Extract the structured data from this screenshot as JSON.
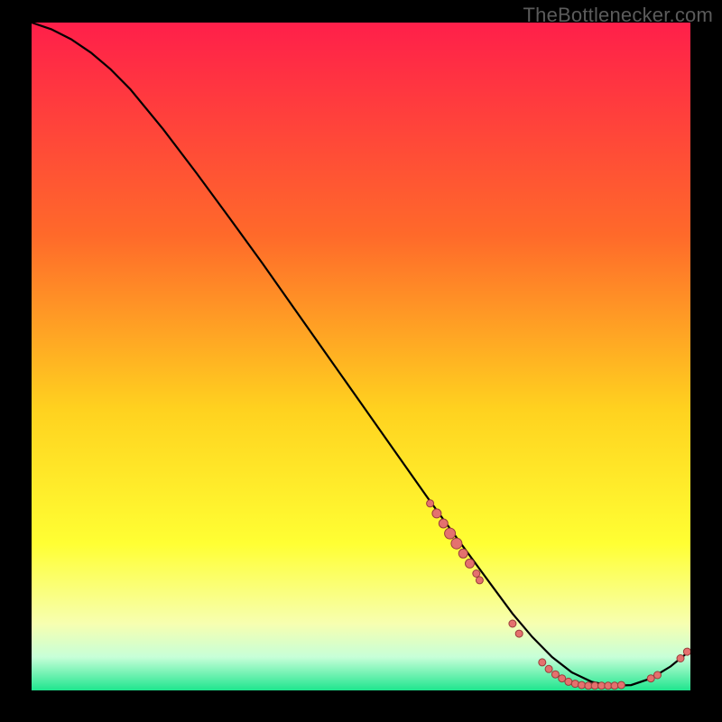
{
  "watermark": "TheBottlenecker.com",
  "colors": {
    "bg_black": "#000000",
    "grad_top": "#ff1f4a",
    "grad_mid1": "#ff6a2a",
    "grad_mid2": "#ffd21f",
    "grad_mid3": "#ffff33",
    "grad_low1": "#f7ffb0",
    "grad_low2": "#c7ffd8",
    "grad_bottom": "#1fe58e",
    "curve": "#000000",
    "dot_fill": "#e4716e",
    "dot_stroke": "#9a3d3b"
  },
  "chart_data": {
    "type": "line",
    "title": "",
    "xlabel": "",
    "ylabel": "",
    "xlim": [
      0,
      100
    ],
    "ylim": [
      0,
      100
    ],
    "series": [
      {
        "name": "curve",
        "x": [
          0,
          3,
          6,
          9,
          12,
          15,
          20,
          25,
          30,
          35,
          40,
          45,
          50,
          55,
          60,
          65,
          70,
          73,
          76,
          79,
          82,
          85,
          88,
          91,
          94,
          97,
          100
        ],
        "y": [
          100,
          99,
          97.5,
          95.5,
          93,
          90,
          84,
          77.5,
          70.8,
          64,
          57,
          50,
          43,
          36,
          29,
          22.2,
          15.5,
          11.5,
          8.0,
          5.0,
          2.7,
          1.3,
          0.7,
          0.8,
          1.8,
          3.6,
          6.0
        ]
      }
    ],
    "cluster_points": [
      {
        "x": 60.5,
        "y": 28.0,
        "r": 4
      },
      {
        "x": 61.5,
        "y": 26.5,
        "r": 5
      },
      {
        "x": 62.5,
        "y": 25.0,
        "r": 5
      },
      {
        "x": 63.5,
        "y": 23.5,
        "r": 6
      },
      {
        "x": 64.5,
        "y": 22.0,
        "r": 6
      },
      {
        "x": 65.5,
        "y": 20.5,
        "r": 5
      },
      {
        "x": 66.5,
        "y": 19.0,
        "r": 5
      },
      {
        "x": 67.5,
        "y": 17.5,
        "r": 4
      },
      {
        "x": 68.0,
        "y": 16.5,
        "r": 4
      },
      {
        "x": 73.0,
        "y": 10.0,
        "r": 4
      },
      {
        "x": 74.0,
        "y": 8.5,
        "r": 4
      },
      {
        "x": 77.5,
        "y": 4.2,
        "r": 4
      },
      {
        "x": 78.5,
        "y": 3.2,
        "r": 4
      },
      {
        "x": 79.5,
        "y": 2.4,
        "r": 4
      },
      {
        "x": 80.5,
        "y": 1.8,
        "r": 4
      },
      {
        "x": 81.5,
        "y": 1.3,
        "r": 4
      },
      {
        "x": 82.5,
        "y": 1.0,
        "r": 4
      },
      {
        "x": 83.5,
        "y": 0.8,
        "r": 4
      },
      {
        "x": 84.5,
        "y": 0.7,
        "r": 4
      },
      {
        "x": 85.5,
        "y": 0.7,
        "r": 4
      },
      {
        "x": 86.5,
        "y": 0.7,
        "r": 4
      },
      {
        "x": 87.5,
        "y": 0.7,
        "r": 4
      },
      {
        "x": 88.5,
        "y": 0.7,
        "r": 4
      },
      {
        "x": 89.5,
        "y": 0.8,
        "r": 4
      },
      {
        "x": 94.0,
        "y": 1.8,
        "r": 4
      },
      {
        "x": 95.0,
        "y": 2.3,
        "r": 4
      },
      {
        "x": 98.5,
        "y": 4.8,
        "r": 4
      },
      {
        "x": 99.5,
        "y": 5.8,
        "r": 4
      }
    ]
  }
}
